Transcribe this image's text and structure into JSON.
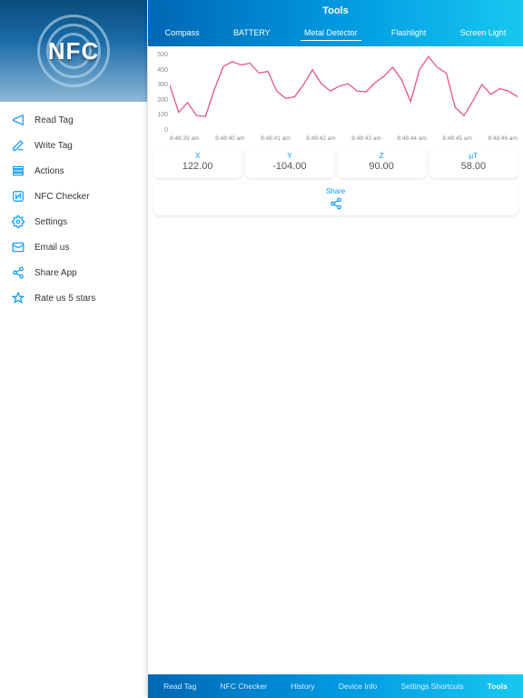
{
  "hero_text": "NFC",
  "sidebar": {
    "items": [
      {
        "label": "Read Tag"
      },
      {
        "label": "Write Tag"
      },
      {
        "label": "Actions"
      },
      {
        "label": "NFC Checker"
      },
      {
        "label": "Settings"
      },
      {
        "label": "Email us"
      },
      {
        "label": "Share App"
      },
      {
        "label": "Rate us 5 stars"
      }
    ]
  },
  "header": {
    "title": "Tools"
  },
  "tabs": [
    {
      "label": "Compass"
    },
    {
      "label": "BATTERY"
    },
    {
      "label": "Metal Detector"
    },
    {
      "label": "Flashlight"
    },
    {
      "label": "Screen Light"
    }
  ],
  "chart_data": {
    "type": "line",
    "ylim": [
      0,
      500
    ],
    "yticks": [
      "500",
      "400",
      "300",
      "200",
      "100",
      "0"
    ],
    "xticks": [
      "8:48:39 am",
      "8:48:40 am",
      "8:48:41 am",
      "8:48:42 am",
      "8:48:43 am",
      "8:48:44 am",
      "8:48:45 am",
      "8:48:46 am"
    ],
    "values": [
      295,
      130,
      190,
      110,
      105,
      270,
      410,
      440,
      420,
      430,
      370,
      380,
      260,
      215,
      225,
      300,
      390,
      305,
      260,
      290,
      305,
      260,
      255,
      310,
      350,
      405,
      330,
      195,
      390,
      470,
      405,
      370,
      160,
      110,
      200,
      300,
      240,
      275,
      260,
      225
    ]
  },
  "cards": [
    {
      "label": "X",
      "value": "122.00"
    },
    {
      "label": "Y",
      "value": "-104.00"
    },
    {
      "label": "Z",
      "value": "90.00"
    },
    {
      "label": "µT",
      "value": "58.00"
    }
  ],
  "share": {
    "label": "Share"
  },
  "bottom": [
    {
      "label": "Read Tag"
    },
    {
      "label": "NFC Checker"
    },
    {
      "label": "History"
    },
    {
      "label": "Device Info"
    },
    {
      "label": "Settings Shortcuts"
    },
    {
      "label": "Tools"
    }
  ]
}
